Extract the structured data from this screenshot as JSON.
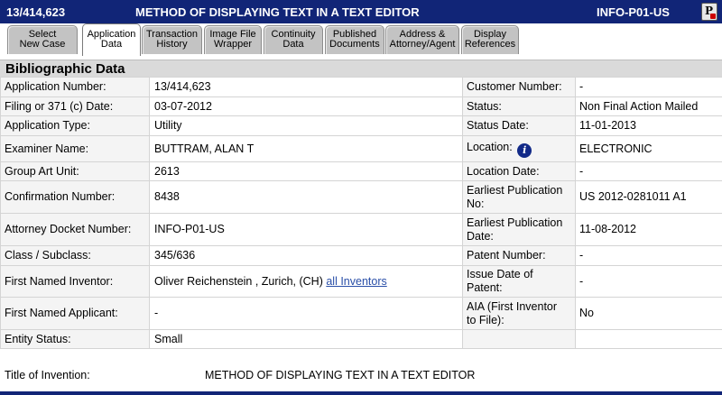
{
  "header": {
    "application_number": "13/414,623",
    "title": "METHOD OF DISPLAYING TEXT IN A TEXT EDITOR",
    "docket": "INFO-P01-US",
    "pdf_icon": "document-icon"
  },
  "tabs": [
    {
      "line1": "Select",
      "line2": "New Case",
      "active": false
    },
    {
      "line1": "Application",
      "line2": "Data",
      "active": true
    },
    {
      "line1": "Transaction",
      "line2": "History",
      "active": false
    },
    {
      "line1": "Image File",
      "line2": "Wrapper",
      "active": false
    },
    {
      "line1": "Continuity",
      "line2": "Data",
      "active": false
    },
    {
      "line1": "Published",
      "line2": "Documents",
      "active": false
    },
    {
      "line1": "Address &",
      "line2": "Attorney/Agent",
      "active": false
    },
    {
      "line1": "Display",
      "line2": "References",
      "active": false
    }
  ],
  "section_title": "Bibliographic Data",
  "rows": [
    {
      "l1": "Application Number:",
      "v1": "13/414,623",
      "l2": "Customer Number:",
      "v2": "-"
    },
    {
      "l1": "Filing or 371 (c) Date:",
      "v1": "03-07-2012",
      "l2": "Status:",
      "v2": "Non Final Action Mailed"
    },
    {
      "l1": "Application Type:",
      "v1": "Utility",
      "l2": "Status Date:",
      "v2": "11-01-2013"
    },
    {
      "l1": "Examiner Name:",
      "v1": "BUTTRAM, ALAN T",
      "l2": "Location:",
      "v2": "ELECTRONIC",
      "icon": "info-icon"
    },
    {
      "l1": "Group Art Unit:",
      "v1": "2613",
      "l2": "Location Date:",
      "v2": "-"
    },
    {
      "l1": "Confirmation Number:",
      "v1": "8438",
      "l2a": "Earliest Publication",
      "l2b": "No:",
      "v2": "US 2012-0281011 A1"
    },
    {
      "l1": "Attorney Docket Number:",
      "v1": "INFO-P01-US",
      "l2a": "Earliest Publication",
      "l2b": "Date:",
      "v2": "11-08-2012"
    },
    {
      "l1": "Class / Subclass:",
      "v1": "345/636",
      "l2": "Patent Number:",
      "v2": "-"
    },
    {
      "l1": "First Named Inventor:",
      "v1": "Oliver Reichenstein , Zurich, (CH)",
      "link": "all Inventors",
      "l2a": "Issue Date of",
      "l2b": "Patent:",
      "v2": "-"
    },
    {
      "l1": "First Named Applicant:",
      "v1": "-",
      "l2a": "AIA (First Inventor",
      "l2b": "to File):",
      "v2": "No"
    },
    {
      "l1": "Entity Status:",
      "v1": "Small",
      "l2": "",
      "v2": ""
    }
  ],
  "title_of_invention": {
    "label": "Title of Invention:",
    "value": "METHOD OF DISPLAYING TEXT IN A TEXT EDITOR"
  }
}
